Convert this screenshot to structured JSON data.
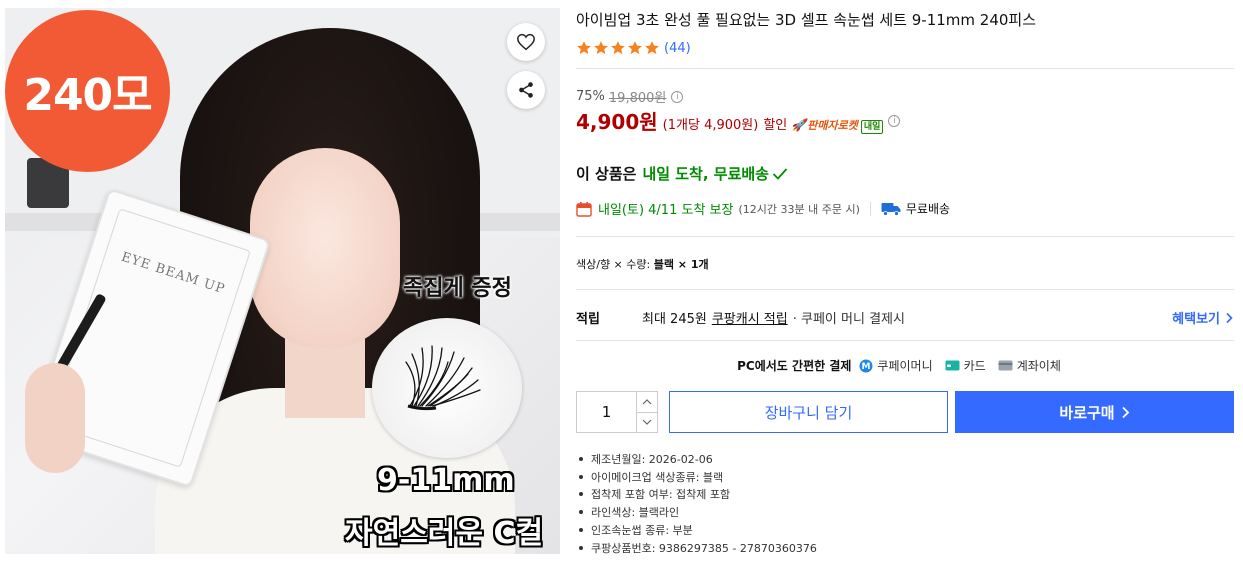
{
  "image": {
    "badge_count": "240모",
    "tweezer_gift": "족집게 증정",
    "lash_size": "9-11mm",
    "curl_type": "자연스러운 C컬",
    "card_brand": "EYE BEAM UP",
    "heart_icon": "heart-icon",
    "share_icon": "share-icon"
  },
  "product": {
    "title": "아이빔업 3초 완성 풀 필요없는 3D 셀프 속눈썹 세트 9-11mm 240피스",
    "rating": 5,
    "star_color": "#f5821f",
    "review_count": "(44)"
  },
  "price": {
    "discount_rate": "75%",
    "original_price": "19,800원",
    "sale_price": "4,900원",
    "unit_price": "(1개당 4,900원)",
    "discount_label": "할인",
    "rocket_label": "판매자로켓",
    "tomorrow_badge": "내일",
    "price_color": "#ae0000"
  },
  "delivery": {
    "arrival_prefix": "이 상품은",
    "arrival_highlight": "내일 도착, 무료배송",
    "date_text": "내일(토) 4/11 도착 보장",
    "condition": "(12시간 33분 내 주문 시)",
    "free_shipping": "무료배송",
    "green": "#008c00"
  },
  "option": {
    "label": "색상/향 × 수량:",
    "value": "블랙 × 1개"
  },
  "points": {
    "label": "적립",
    "max_text": "최대 245원",
    "cash_link": "쿠팡캐시 적립",
    "pay_text": "· 쿠페이 머니 결제시",
    "benefit_link": "혜택보기"
  },
  "payment": {
    "title": "PC에서도 간편한 결제",
    "methods": [
      "쿠페이머니",
      "카드",
      "계좌이체"
    ]
  },
  "purchase": {
    "quantity": "1",
    "cart_label": "장바구니 담기",
    "buy_label": "바로구매",
    "accent": "#346aff"
  },
  "attributes": [
    "제조년월일: 2026-02-06",
    "아이메이크업 색상종류: 블랙",
    "접착제 포함 여부: 접착제 포함",
    "라인색상: 블랙라인",
    "인조속눈썹 종류: 부분",
    "쿠팡상품번호: 9386297385 - 27870360376"
  ]
}
